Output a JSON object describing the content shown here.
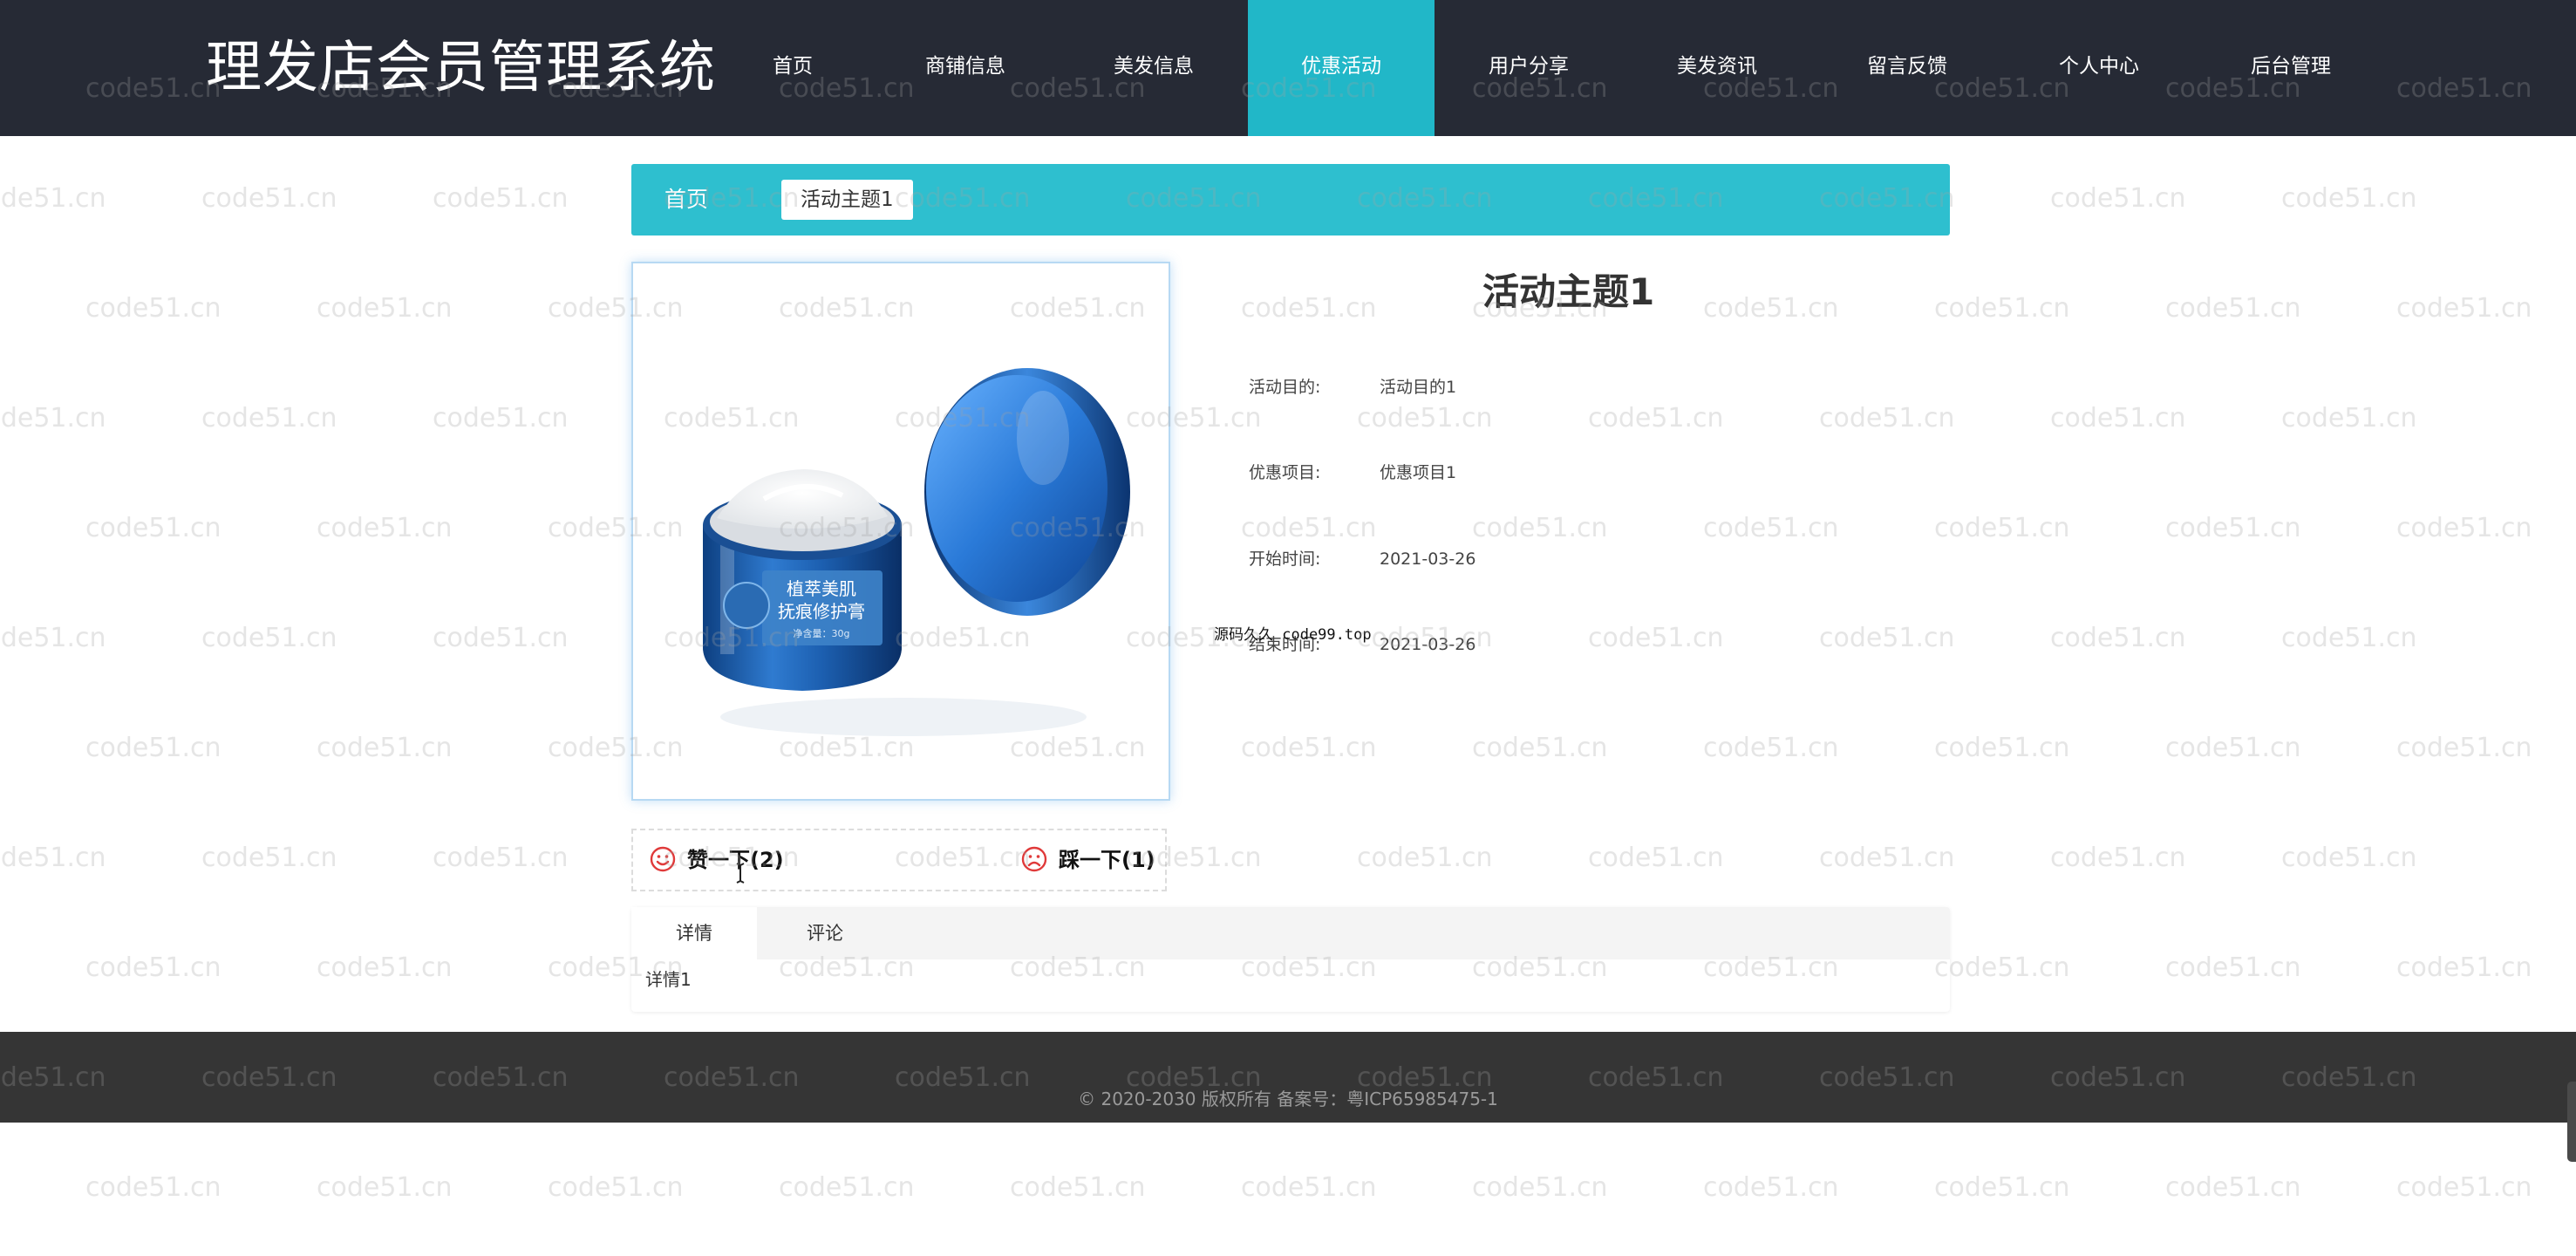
{
  "header": {
    "site_title": "理发店会员管理系统",
    "nav": [
      {
        "label": "首页",
        "name": "nav-home"
      },
      {
        "label": "商铺信息",
        "name": "nav-shop-info"
      },
      {
        "label": "美发信息",
        "name": "nav-hair-info"
      },
      {
        "label": "优惠活动",
        "name": "nav-promotions",
        "active": true
      },
      {
        "label": "用户分享",
        "name": "nav-user-share"
      },
      {
        "label": "美发资讯",
        "name": "nav-hair-news"
      },
      {
        "label": "留言反馈",
        "name": "nav-feedback"
      },
      {
        "label": "个人中心",
        "name": "nav-profile"
      },
      {
        "label": "后台管理",
        "name": "nav-admin"
      }
    ]
  },
  "breadcrumb": {
    "home": "首页",
    "current": "活动主题1"
  },
  "product_image": {
    "label_lines": [
      "植萃美肌",
      "抚痕修护膏"
    ],
    "net_weight": "净含量：30g"
  },
  "detail": {
    "title": "活动主题1",
    "fields": [
      {
        "label": "活动目的:",
        "value": "活动目的1"
      },
      {
        "label": "优惠项目:",
        "value": "优惠项目1"
      },
      {
        "label": "开始时间:",
        "value": "2021-03-26"
      },
      {
        "label": "结束时间:",
        "value": "2021-03-26"
      }
    ]
  },
  "overlay_note": "源码久久 code99.top",
  "votes": {
    "like": "赞一下(2)",
    "dislike": "踩一下(1)"
  },
  "tabs": {
    "items": [
      {
        "label": "详情",
        "active": true
      },
      {
        "label": "评论",
        "active": false
      }
    ],
    "content": "详情1"
  },
  "footer": {
    "copyright": "© 2020-2030 版权所有 备案号：粤ICP65985475-1"
  },
  "watermark": "code51.cn",
  "colors": {
    "header_bg": "#262a35",
    "accent": "#21b7c8",
    "breadcrumb_bg": "#2ebfcf",
    "footer_bg": "#353535",
    "vote_icon": "#e03a3a"
  }
}
